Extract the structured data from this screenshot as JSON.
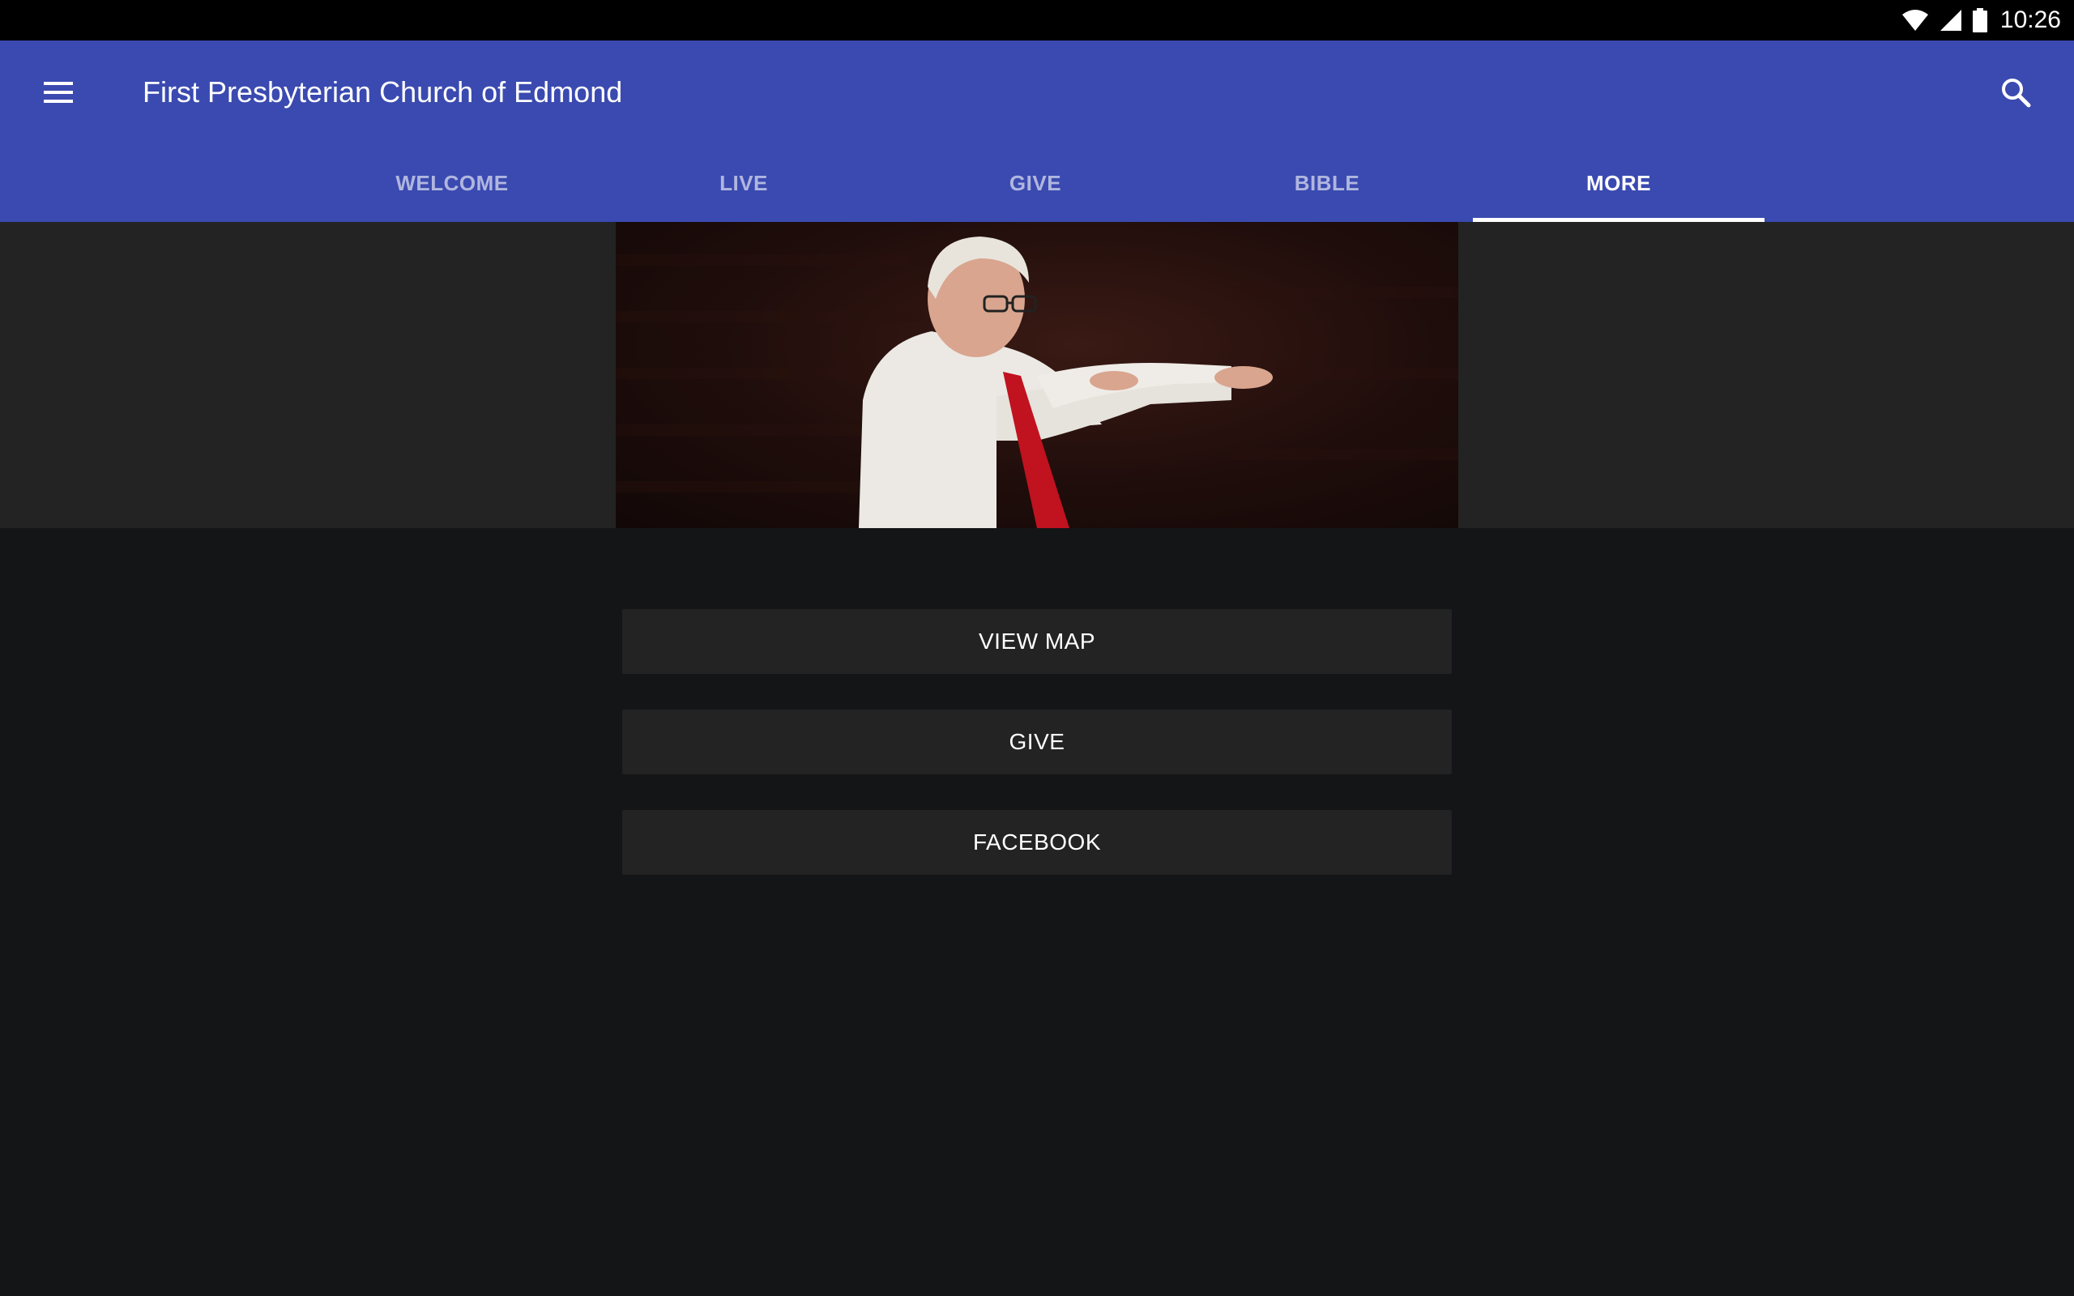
{
  "status_bar": {
    "time": "10:26",
    "icons": [
      "wifi-icon",
      "cell-signal-icon",
      "battery-icon"
    ]
  },
  "toolbar": {
    "title": "First Presbyterian Church of Edmond",
    "menu_icon": "hamburger-menu-icon",
    "search_icon": "search-icon",
    "background_color": "#3a4ab0"
  },
  "tabs": [
    {
      "label": "WELCOME",
      "active": false
    },
    {
      "label": "LIVE",
      "active": false
    },
    {
      "label": "GIVE",
      "active": false
    },
    {
      "label": "BIBLE",
      "active": false
    },
    {
      "label": "MORE",
      "active": true
    }
  ],
  "hero": {
    "image": "photo of a man in a white shirt and red tie conducting"
  },
  "actions": [
    {
      "label": "VIEW MAP"
    },
    {
      "label": "GIVE"
    },
    {
      "label": "FACEBOOK"
    }
  ]
}
